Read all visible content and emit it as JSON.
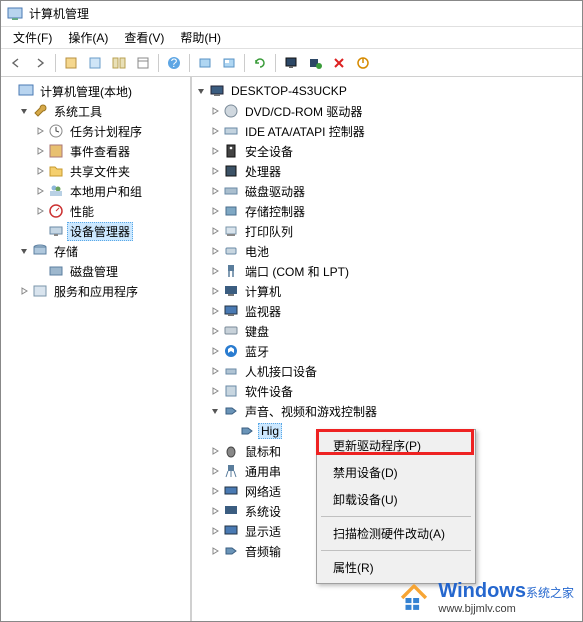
{
  "window": {
    "title": "计算机管理"
  },
  "menubar": [
    "文件(F)",
    "操作(A)",
    "查看(V)",
    "帮助(H)"
  ],
  "left_tree": {
    "root": "计算机管理(本地)",
    "groups": [
      {
        "label": "系统工具",
        "children": [
          "任务计划程序",
          "事件查看器",
          "共享文件夹",
          "本地用户和组",
          "性能",
          "设备管理器"
        ],
        "selected_index": 5
      },
      {
        "label": "存储",
        "children": [
          "磁盘管理"
        ]
      },
      {
        "label": "服务和应用程序",
        "children": []
      }
    ]
  },
  "right_tree": {
    "root": "DESKTOP-4S3UCKP",
    "nodes": [
      "DVD/CD-ROM 驱动器",
      "IDE ATA/ATAPI 控制器",
      "安全设备",
      "处理器",
      "磁盘驱动器",
      "存储控制器",
      "打印队列",
      "电池",
      "端口 (COM 和 LPT)",
      "计算机",
      "监视器",
      "键盘",
      "蓝牙",
      "人机接口设备",
      "软件设备",
      "声音、视频和游戏控制器",
      "鼠标和",
      "通用串",
      "网络适",
      "系统设",
      "显示适",
      "音频输"
    ],
    "expanded_node_index": 15,
    "expanded_child": "Hig"
  },
  "context_menu": {
    "items": [
      "更新驱动程序(P)",
      "禁用设备(D)",
      "卸载设备(U)"
    ],
    "items2": [
      "扫描检测硬件改动(A)"
    ],
    "items3": [
      "属性(R)"
    ]
  },
  "watermark": {
    "brand": "Windows",
    "suffix": "系统之家",
    "url": "www.bjjmlv.com"
  }
}
